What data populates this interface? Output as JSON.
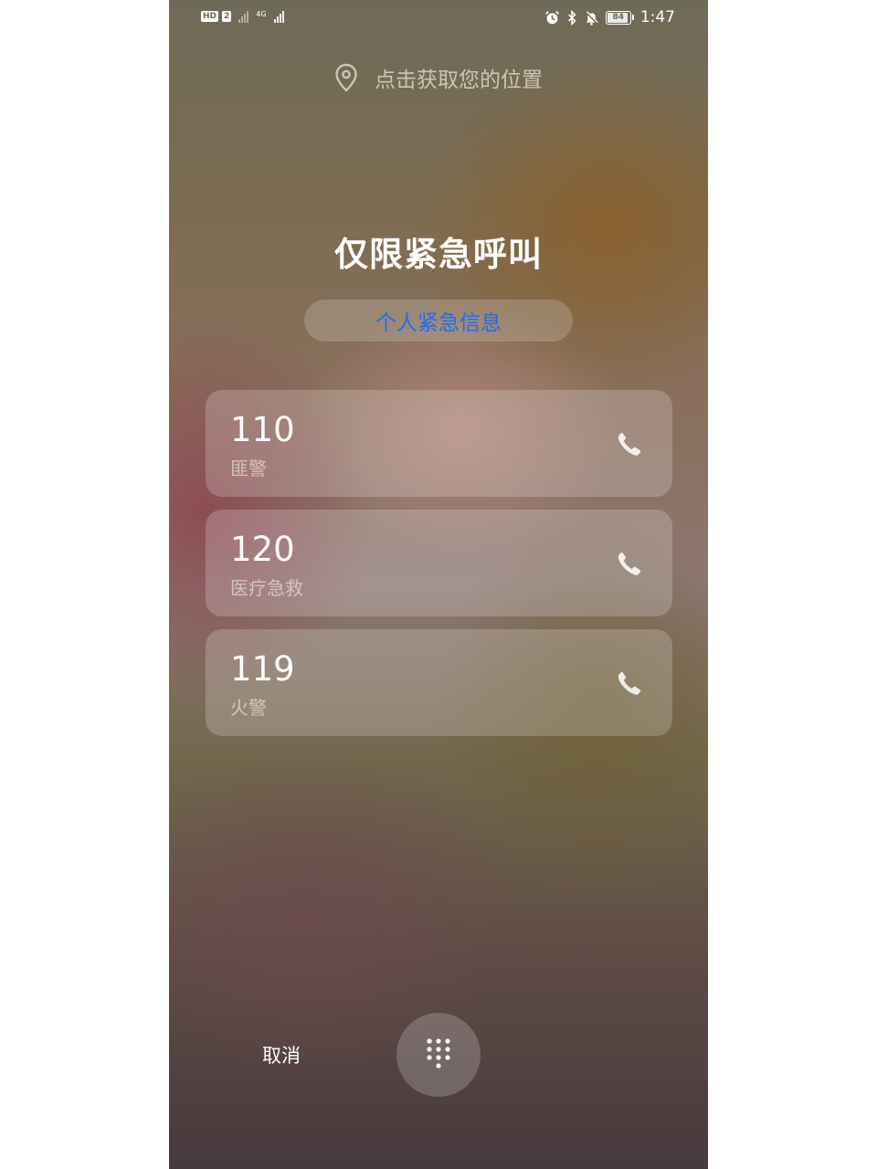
{
  "status_bar": {
    "hd_label": "HD",
    "sim_label": "2",
    "network_label": "4G",
    "battery_level": "84",
    "time": "1:47",
    "icons": [
      "alarm-icon",
      "bluetooth-icon",
      "mute-bell-icon"
    ]
  },
  "location": {
    "label": "点击获取您的位置",
    "icon": "location-pin-icon"
  },
  "title": "仅限紧急呼叫",
  "personal_info_button": "个人紧急信息",
  "emergency_numbers": [
    {
      "number": "110",
      "label": "匪警"
    },
    {
      "number": "120",
      "label": "医疗急救"
    },
    {
      "number": "119",
      "label": "火警"
    }
  ],
  "footer": {
    "cancel_label": "取消",
    "dialpad_icon": "dialpad-icon"
  },
  "colors": {
    "accent": "#1f6fe8",
    "text_primary": "#ffffff"
  }
}
